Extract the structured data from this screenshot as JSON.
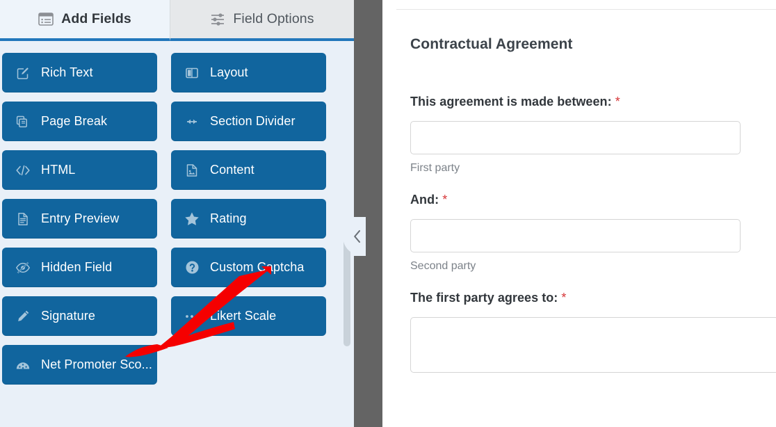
{
  "panel": {
    "tabs": [
      {
        "label": "Add Fields",
        "icon": "list-panel-icon",
        "active": true
      },
      {
        "label": "Field Options",
        "icon": "sliders-icon",
        "active": false
      }
    ],
    "fields": [
      {
        "label": "Rich Text",
        "icon": "pencil-square-icon"
      },
      {
        "label": "Layout",
        "icon": "columns-icon"
      },
      {
        "label": "Page Break",
        "icon": "copy-pages-icon"
      },
      {
        "label": "Section Divider",
        "icon": "arrows-horizontal-icon"
      },
      {
        "label": "HTML",
        "icon": "code-brackets-icon"
      },
      {
        "label": "Content",
        "icon": "image-document-icon"
      },
      {
        "label": "Entry Preview",
        "icon": "document-lines-icon"
      },
      {
        "label": "Rating",
        "icon": "star-icon"
      },
      {
        "label": "Hidden Field",
        "icon": "eye-slash-icon"
      },
      {
        "label": "Custom Captcha",
        "icon": "question-circle-icon"
      },
      {
        "label": "Signature",
        "icon": "pen-icon"
      },
      {
        "label": "Likert Scale",
        "icon": "dots-row-icon"
      },
      {
        "label": "Net Promoter Sco...",
        "icon": "gauge-icon"
      }
    ],
    "scrollbar": {
      "name": "panel-vertical-scrollbar"
    },
    "collapse_icon": "chevron-left-icon"
  },
  "preview": {
    "form_title": "Contractual Agreement",
    "fields": [
      {
        "label": "This agreement is made between:",
        "required_marker": "*",
        "value": "",
        "placeholder": "",
        "sublabel": "First party",
        "type": "text"
      },
      {
        "label": "And:",
        "required_marker": "*",
        "value": "",
        "placeholder": "",
        "sublabel": "Second party",
        "type": "text"
      },
      {
        "label": "The first party agrees to:",
        "required_marker": "*",
        "value": "",
        "placeholder": "",
        "sublabel": "",
        "type": "textarea"
      }
    ]
  },
  "annotation": {
    "type": "arrow",
    "color": "#f50000",
    "points_to": "Signature"
  },
  "colors": {
    "field_button": "#11659e",
    "panel_background": "#e9f0f8",
    "divider": "#646464",
    "tab_underline": "#2277bb",
    "required_star": "#d63638",
    "annotation_red": "#f50000"
  }
}
